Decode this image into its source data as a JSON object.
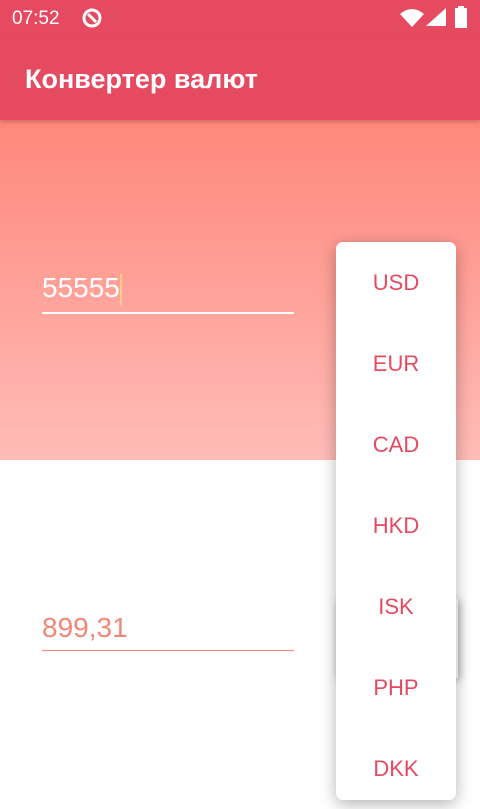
{
  "status_bar": {
    "time": "07:52"
  },
  "app_bar": {
    "title": "Конвертер валют"
  },
  "from": {
    "value": "55555"
  },
  "to": {
    "value": "899,31"
  },
  "dropdown": {
    "options": [
      "USD",
      "EUR",
      "CAD",
      "HKD",
      "ISK",
      "PHP",
      "DKK"
    ]
  },
  "colors": {
    "primary": "#e64a60",
    "gradient_top": "#ff877a",
    "gradient_bottom": "#ffbcb8"
  }
}
